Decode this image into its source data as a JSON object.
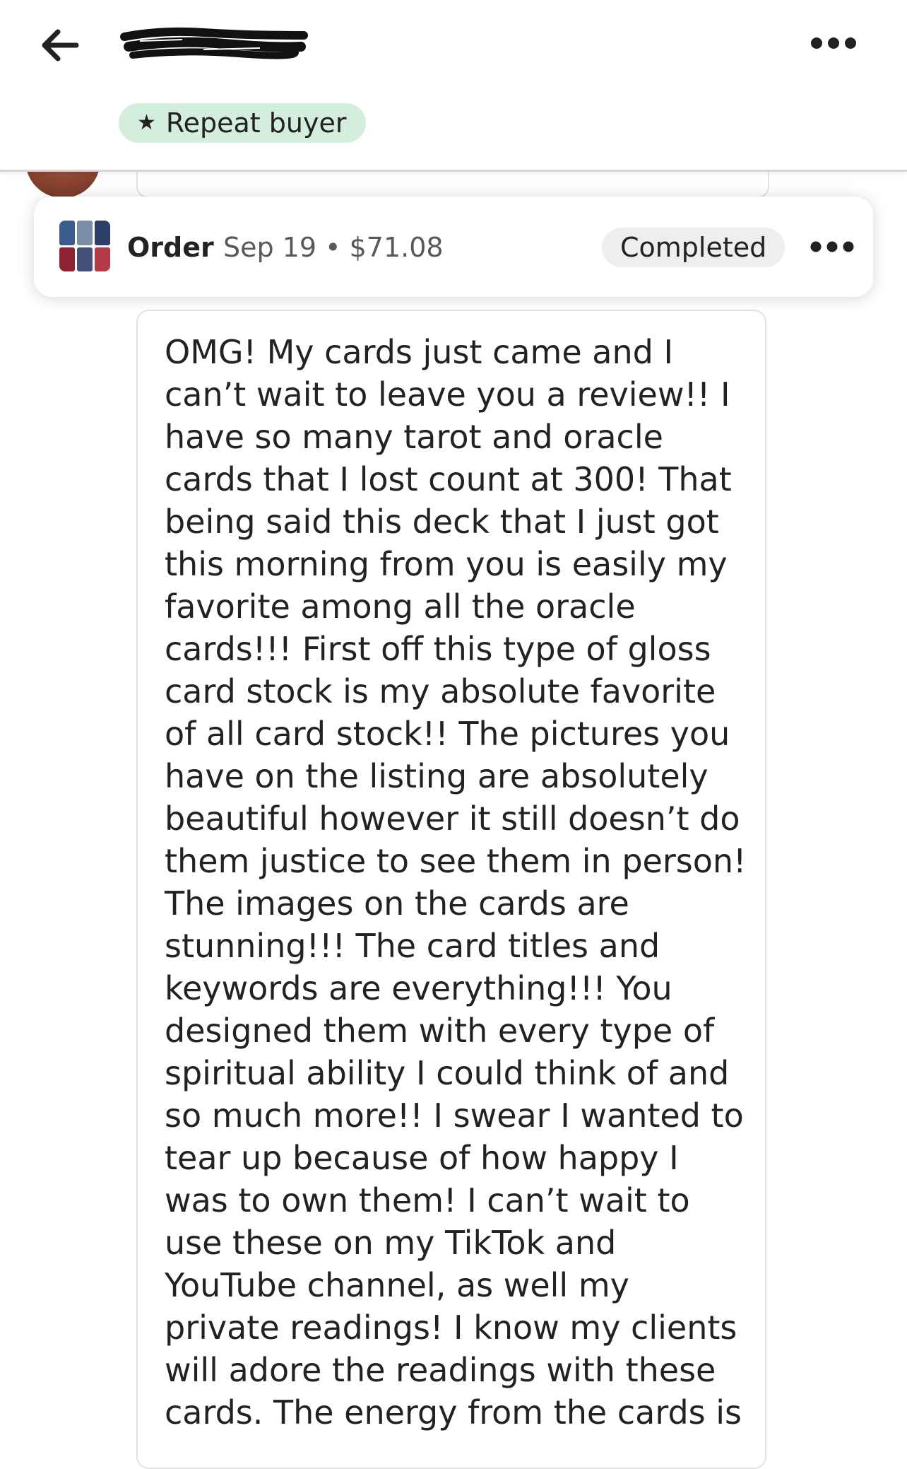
{
  "header": {
    "back_icon": "arrow-left-icon",
    "buyer_name_redacted": true,
    "more_icon": "more-horizontal-icon",
    "badge": {
      "icon": "star-icon",
      "label": "Repeat buyer",
      "bg_color": "#d4eedd"
    }
  },
  "order": {
    "thumbnail_icon": "product-thumbnail",
    "label": "Order",
    "meta": "Sep 19 • $71.08",
    "status": "Completed",
    "more_icon": "more-horizontal-icon"
  },
  "message": {
    "lines": [
      "OMG! My cards just came and I",
      "can’t wait to leave you a review!! I",
      "have so many tarot and oracle",
      "cards that I lost count at 300! That",
      "being said this deck that I just got",
      "this morning from you is easily my",
      "favorite among all the oracle",
      "cards!!! First off this type of gloss",
      "card stock is my absolute favorite",
      "of all card stock!! The pictures you",
      "have on the listing are absolutely",
      "beautiful however it still doesn’t do",
      "them justice to see them in person!",
      "The images on the cards are",
      "stunning!!! The card titles and",
      "keywords are everything!!! You",
      "designed them with every type of",
      "spiritual ability I could think of and",
      "so much more!! I swear I wanted to",
      "tear up because of how happy I",
      "was to own them! I can’t wait to",
      "use these on my TikTok and",
      "YouTube channel, as well my",
      "private readings! I know my clients",
      "will adore the readings with these",
      "cards. The energy from the cards is"
    ]
  }
}
